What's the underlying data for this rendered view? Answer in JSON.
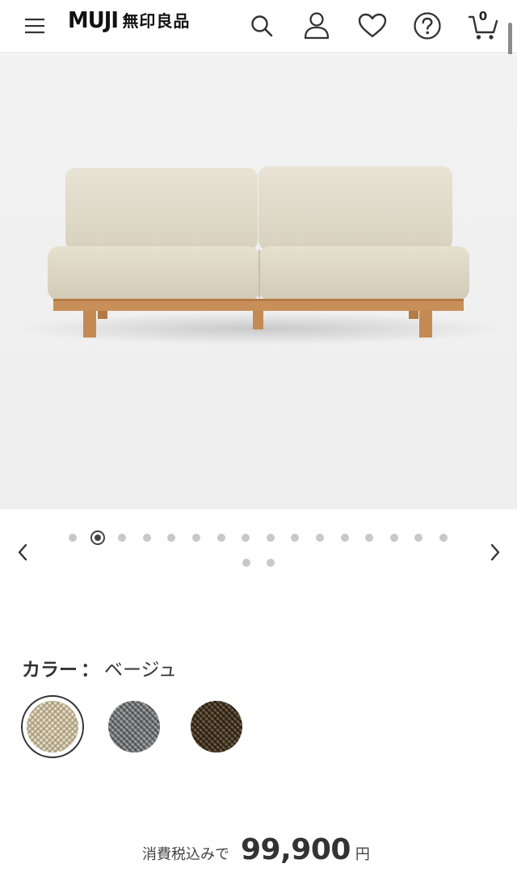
{
  "header": {
    "logo_latin": "MUJI",
    "logo_japanese": "無印良品",
    "cart_count": "0",
    "icons": [
      "menu-icon",
      "search-icon",
      "user-icon",
      "heart-icon",
      "help-icon",
      "cart-icon"
    ]
  },
  "carousel": {
    "total_images": 18,
    "active_index": 1
  },
  "product": {
    "color_label": "カラー",
    "color_separator": "：",
    "color_value": "ベージュ",
    "swatches": [
      {
        "name": "ベージュ",
        "color": "#e6dcc6",
        "selected": true
      },
      {
        "name": "gray",
        "color": "#7d7f80",
        "selected": false
      },
      {
        "name": "brown",
        "color": "#4a3d2c",
        "selected": false
      }
    ],
    "price_prefix": "消費税込みで",
    "price": "99,900",
    "price_unit": "円"
  },
  "colors": {
    "text": "#222222",
    "dot_inactive": "#c8c8c8",
    "dot_active": "#444444",
    "sofa_fabric": "#e2dccb",
    "sofa_wood": "#c8925a"
  }
}
